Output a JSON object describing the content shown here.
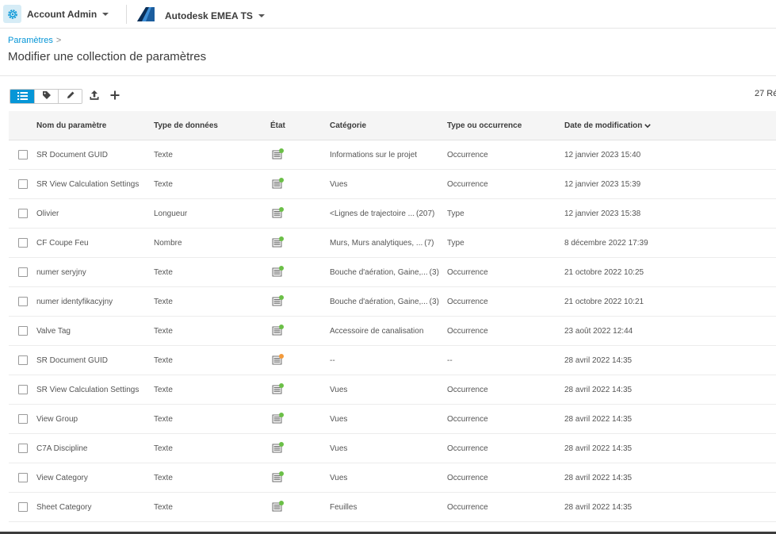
{
  "topbar": {
    "app_name": "Account Admin",
    "hub_name": "Autodesk EMEA TS"
  },
  "breadcrumb": {
    "parent": "Paramètres",
    "separator": ">"
  },
  "page_title": "Modifier une collection de paramètres",
  "toolbar": {
    "count": "27 Ré"
  },
  "table": {
    "headers": {
      "name": "Nom du paramètre",
      "type": "Type de données",
      "state": "État",
      "category": "Catégorie",
      "occurrence": "Type ou occurrence",
      "date": "Date de modification"
    },
    "rows": [
      {
        "name": "SR Document GUID",
        "type": "Texte",
        "state": "ok",
        "category": "Informations sur le projet",
        "category_count": "",
        "occurrence": "Occurrence",
        "date": "12 janvier 2023 15:40"
      },
      {
        "name": "SR View Calculation Settings",
        "type": "Texte",
        "state": "ok",
        "category": "Vues",
        "category_count": "",
        "occurrence": "Occurrence",
        "date": "12 janvier 2023 15:39"
      },
      {
        "name": "Olivier",
        "type": "Longueur",
        "state": "ok",
        "category": "<Lignes de trajectoire ...",
        "category_count": "(207)",
        "occurrence": "Type",
        "date": "12 janvier 2023 15:38"
      },
      {
        "name": "CF Coupe Feu",
        "type": "Nombre",
        "state": "ok",
        "category": "Murs, Murs analytiques, ...",
        "category_count": "(7)",
        "occurrence": "Type",
        "date": "8 décembre 2022 17:39"
      },
      {
        "name": "numer seryjny",
        "type": "Texte",
        "state": "ok",
        "category": "Bouche d'aération, Gaine,...",
        "category_count": "(3)",
        "occurrence": "Occurrence",
        "date": "21 octobre 2022 10:25"
      },
      {
        "name": "numer identyfikacyjny",
        "type": "Texte",
        "state": "ok",
        "category": "Bouche d'aération, Gaine,...",
        "category_count": "(3)",
        "occurrence": "Occurrence",
        "date": "21 octobre 2022 10:21"
      },
      {
        "name": "Valve Tag",
        "type": "Texte",
        "state": "ok",
        "category": "Accessoire de canalisation",
        "category_count": "",
        "occurrence": "Occurrence",
        "date": "23 août 2022 12:44"
      },
      {
        "name": "SR Document GUID",
        "type": "Texte",
        "state": "warning",
        "category": "--",
        "category_count": "",
        "occurrence": "--",
        "date": "28 avril 2022 14:35"
      },
      {
        "name": "SR View Calculation Settings",
        "type": "Texte",
        "state": "ok",
        "category": "Vues",
        "category_count": "",
        "occurrence": "Occurrence",
        "date": "28 avril 2022 14:35"
      },
      {
        "name": "View Group",
        "type": "Texte",
        "state": "ok",
        "category": "Vues",
        "category_count": "",
        "occurrence": "Occurrence",
        "date": "28 avril 2022 14:35"
      },
      {
        "name": "C7A Discipline",
        "type": "Texte",
        "state": "ok",
        "category": "Vues",
        "category_count": "",
        "occurrence": "Occurrence",
        "date": "28 avril 2022 14:35"
      },
      {
        "name": "View Category",
        "type": "Texte",
        "state": "ok",
        "category": "Vues",
        "category_count": "",
        "occurrence": "Occurrence",
        "date": "28 avril 2022 14:35"
      },
      {
        "name": "Sheet Category",
        "type": "Texte",
        "state": "ok",
        "category": "Feuilles",
        "category_count": "",
        "occurrence": "Occurrence",
        "date": "28 avril 2022 14:35"
      }
    ]
  },
  "colors": {
    "accent": "#0696d7",
    "state_ok": "#6bbf47",
    "state_warning": "#f39a3a"
  },
  "icons": {
    "app": "gear-icon",
    "hub": "autodesk-logo-icon",
    "views": [
      "list-view-icon",
      "tag-icon",
      "pencil-icon"
    ],
    "actions": [
      "upload-icon",
      "plus-icon"
    ],
    "sort": "chevron-down-icon",
    "state": "parameter-state-icon"
  }
}
